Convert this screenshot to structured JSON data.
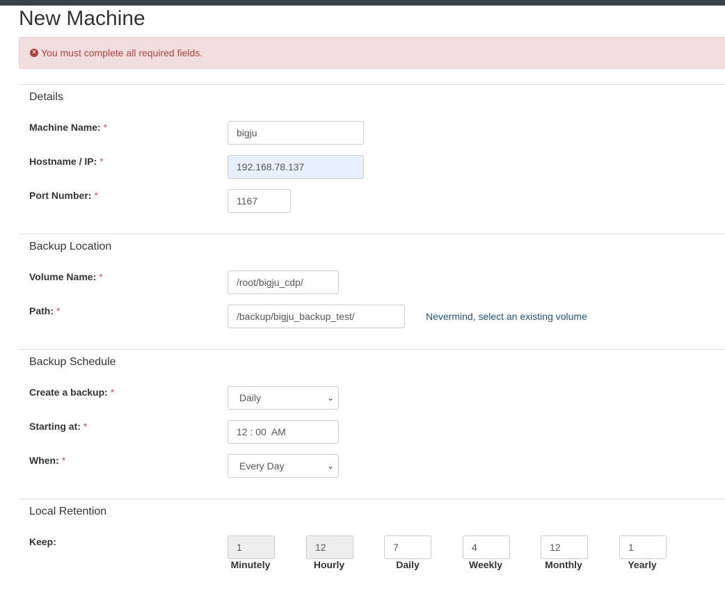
{
  "page": {
    "title": "New Machine"
  },
  "alert": {
    "icon": "error-circle-icon",
    "message": "You must complete all required fields."
  },
  "details": {
    "title": "Details",
    "machine_name": {
      "label": "Machine Name:",
      "value": "bigju"
    },
    "hostname": {
      "label": "Hostname / IP:",
      "value": "192.168.78.137"
    },
    "port": {
      "label": "Port Number:",
      "value": "1167"
    },
    "required_mark": "*"
  },
  "backup_location": {
    "title": "Backup Location",
    "volume_name": {
      "label": "Volume Name:",
      "value": "/root/bigju_cdp/"
    },
    "path": {
      "label": "Path:",
      "value": "/backup/bigju_backup_test/"
    },
    "nevermind_link": "Nevermind, select an existing volume"
  },
  "backup_schedule": {
    "title": "Backup Schedule",
    "create_backup": {
      "label": "Create a backup:",
      "value": "Daily"
    },
    "starting_at": {
      "label": "Starting at:",
      "value": "12 : 00  AM"
    },
    "when": {
      "label": "When:",
      "value": "Every Day"
    }
  },
  "local_retention": {
    "title": "Local Retention",
    "keep_label": "Keep:",
    "items": [
      {
        "label": "Minutely",
        "value": "1",
        "disabled": true
      },
      {
        "label": "Hourly",
        "value": "12",
        "disabled": true
      },
      {
        "label": "Daily",
        "value": "7",
        "disabled": false
      },
      {
        "label": "Weekly",
        "value": "4",
        "disabled": false
      },
      {
        "label": "Monthly",
        "value": "12",
        "disabled": false
      },
      {
        "label": "Yearly",
        "value": "1",
        "disabled": false
      }
    ]
  },
  "colors": {
    "accent_link": "#23527c",
    "alert_text": "#a94442",
    "alert_bg": "#f2dede",
    "required": "#d9534f"
  }
}
